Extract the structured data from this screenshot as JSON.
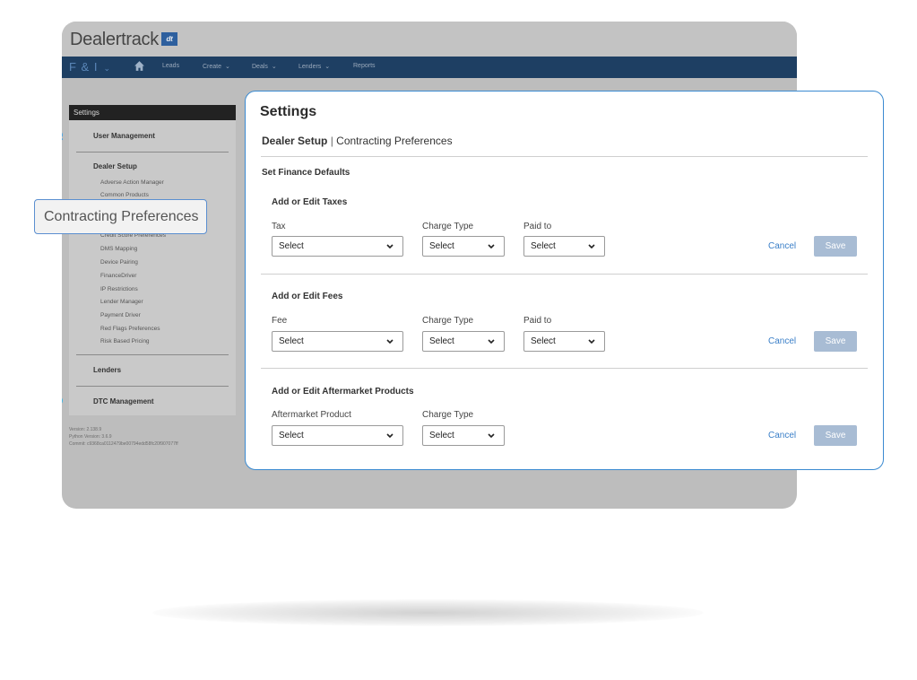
{
  "app": {
    "logo_text": "Dealertrack",
    "logo_badge": "dt",
    "nav": {
      "module": "F & I",
      "items": [
        "Leads",
        "Create",
        "Deals",
        "Lenders",
        "Reports"
      ]
    }
  },
  "sidebar": {
    "heading": "Settings",
    "sections": {
      "user_management": "User Management",
      "dealer_setup": "Dealer Setup",
      "lenders": "Lenders",
      "dtc_management": "DTC Management"
    },
    "dealer_setup_items": [
      "Adverse Action Manager",
      "Common Products",
      "Credit Score Preferences",
      "DMS Mapping",
      "Device Pairing",
      "FinanceDriver",
      "IP Restrictions",
      "Lender Manager",
      "Payment Driver",
      "Red Flags Preferences",
      "Risk Based Pricing"
    ],
    "version": "Version: 2.138.9",
    "python_version": "Python Version: 3.6.9",
    "commit": "Commit: c9368ca0112479be00794edd58fc20f907077ff"
  },
  "callout": "Contracting Preferences",
  "panel": {
    "title": "Settings",
    "breadcrumb_bold": "Dealer Setup",
    "breadcrumb_sep": "|",
    "breadcrumb_rest": "Contracting Preferences",
    "subtitle": "Set Finance Defaults",
    "cancel_label": "Cancel",
    "save_label": "Save",
    "taxes": {
      "title": "Add or Edit Taxes",
      "labels": [
        "Tax",
        "Charge Type",
        "Paid to"
      ],
      "values": [
        "Select",
        "Select",
        "Select"
      ]
    },
    "fees": {
      "title": "Add or Edit Fees",
      "labels": [
        "Fee",
        "Charge Type",
        "Paid to"
      ],
      "values": [
        "Select",
        "Select",
        "Select"
      ]
    },
    "aftermarket": {
      "title": "Add or Edit Aftermarket Products",
      "labels": [
        "Aftermarket Product",
        "Charge Type"
      ],
      "values": [
        "Select",
        "Select"
      ]
    }
  }
}
